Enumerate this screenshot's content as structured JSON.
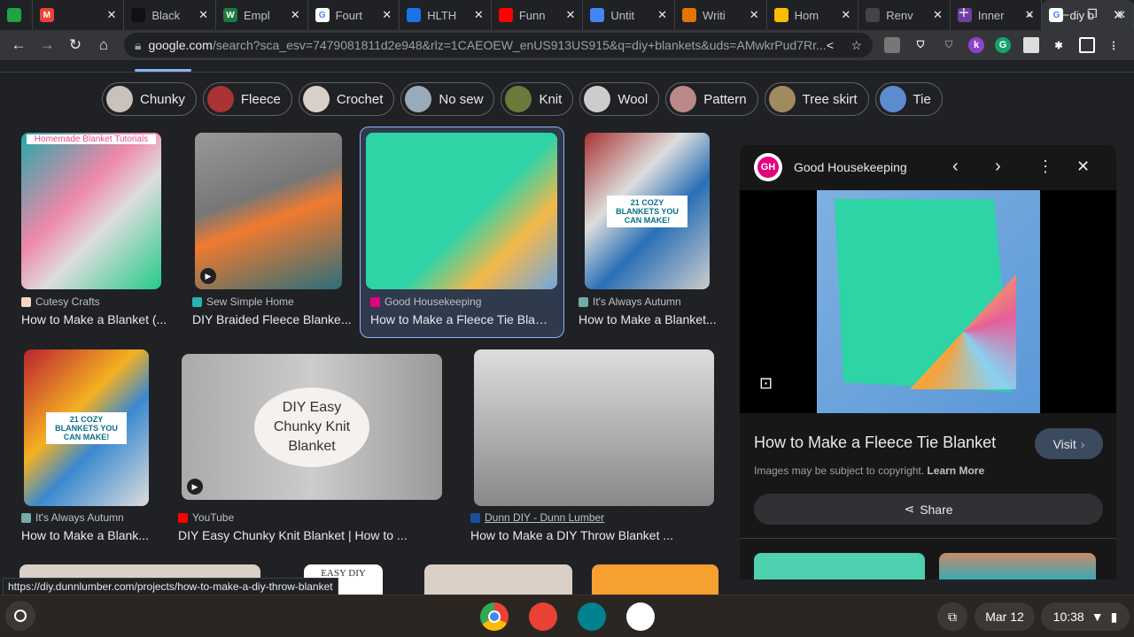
{
  "tabs": [
    {
      "title": "",
      "color": "#1ea446",
      "icon": "android-messages-icon"
    },
    {
      "title": "",
      "color": "#ea4335",
      "icon": "gmail-icon",
      "letter": "M"
    },
    {
      "title": "Black",
      "color": "#111",
      "icon": "chart-icon"
    },
    {
      "title": "Empl",
      "color": "#1e7a3c",
      "icon": "word-icon",
      "letter": "W"
    },
    {
      "title": "Fourt",
      "color": "#fff",
      "icon": "google-icon",
      "letter": "G"
    },
    {
      "title": "HLTH",
      "color": "#1a73e8",
      "icon": "classroom-icon"
    },
    {
      "title": "Funn",
      "color": "#ff0000",
      "icon": "youtube-icon"
    },
    {
      "title": "Untit",
      "color": "#4285f4",
      "icon": "docs-icon"
    },
    {
      "title": "Writi",
      "color": "#e37400",
      "icon": "slides-icon"
    },
    {
      "title": "Hom",
      "color": "#fbbc04",
      "icon": "classroom-icon"
    },
    {
      "title": "Renv",
      "color": "#444",
      "icon": "renew-icon"
    },
    {
      "title": "Inner",
      "color": "#6e3fa3",
      "icon": "inner-icon"
    },
    {
      "title": "diy b",
      "color": "#fff",
      "icon": "google-icon",
      "letter": "G",
      "active": true
    }
  ],
  "address": {
    "domain": "google.com",
    "path": "/search?sca_esv=7479081811d2e948&rlz=1CAEOEW_enUS913US915&q=diy+blankets&uds=AMwkrPud7Rr..."
  },
  "chips": [
    "Chunky",
    "Fleece",
    "Crochet",
    "No sew",
    "Knit",
    "Wool",
    "Pattern",
    "Tree skirt",
    "Tie"
  ],
  "results": [
    {
      "source": "Cutesy Crafts",
      "title": "How to Make a Blanket (...",
      "overlay": "Homemade Blanket Tutorials",
      "favcolor": "#f3d6c8"
    },
    {
      "source": "Sew Simple Home",
      "title": "DIY Braided Fleece Blanke...",
      "favcolor": "#27b3b0"
    },
    {
      "source": "Good Housekeeping",
      "title": "How to Make a Fleece Tie Blan...",
      "favcolor": "#e6007e"
    },
    {
      "source": "It's Always Autumn",
      "title": "How to Make a Blanket...",
      "overlay": "21 COZY BLANKETS YOU CAN MAKE!",
      "favcolor": "#7aa"
    },
    {
      "source": "It's Always Autumn",
      "title": "How to Make a Blank...",
      "overlay": "21 COZY BLANKETS YOU CAN MAKE!",
      "favcolor": "#7aa"
    },
    {
      "source": "YouTube",
      "title": "DIY Easy Chunky Knit Blanket | How to ...",
      "overlay": "DIY Easy Chunky Knit Blanket",
      "favcolor": "#ff0000"
    },
    {
      "source": "Dunn DIY - Dunn Lumber",
      "title": "How to Make a DIY Throw Blanket ...",
      "favcolor": "#1a4fa0"
    }
  ],
  "row3_overlay": "EASY DIY",
  "panel": {
    "source": "Good Housekeeping",
    "logo": "GH",
    "title": "How to Make a Fleece Tie Blanket",
    "visit": "Visit",
    "copyright": "Images may be subject to copyright.",
    "learn_more": "Learn More",
    "share": "Share"
  },
  "status_url": "https://diy.dunnlumber.com/projects/how-to-make-a-diy-throw-blanket",
  "shelf": {
    "date": "Mar 12",
    "time": "10:38"
  }
}
